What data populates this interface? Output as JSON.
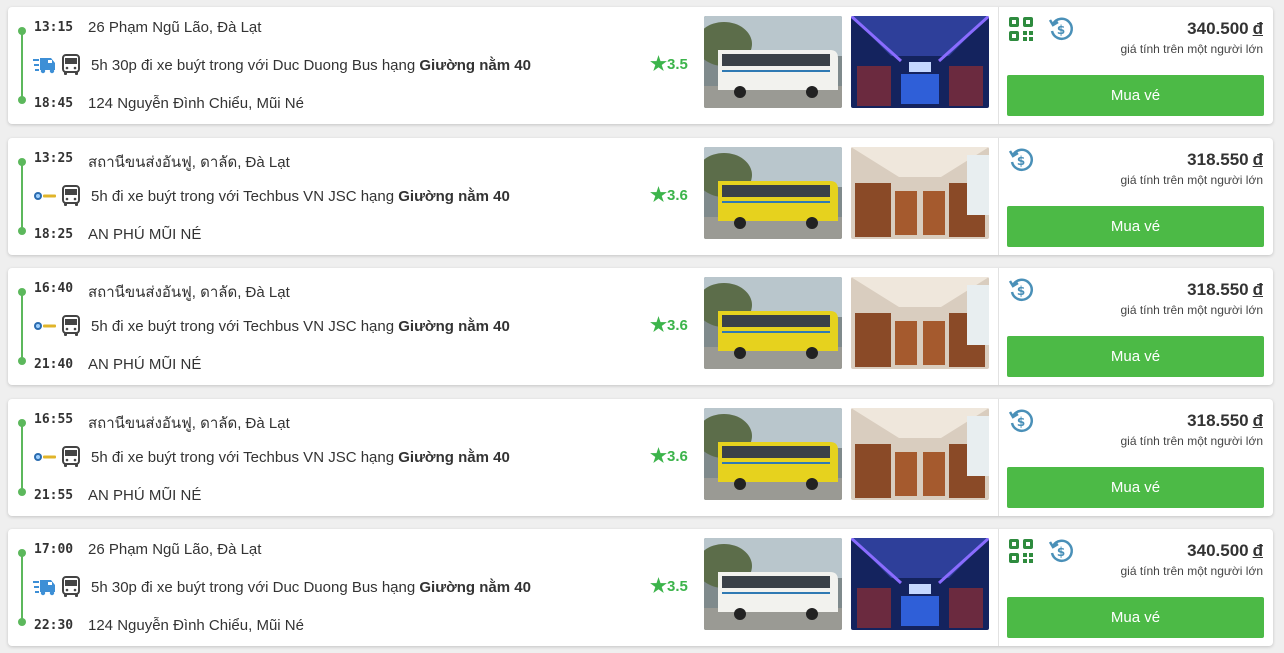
{
  "trips": [
    {
      "departure_time": "13:15",
      "departure_stop": "26 Phạm Ngũ Lão, Đà Lạt",
      "arrival_time": "18:45",
      "arrival_stop": "124 Nguyễn Đình Chiểu, Mũi Né",
      "operator_logo": "fast-bus-icon",
      "desc_prefix": "5h 30p đi xe buýt trong với Duc Duong Bus hạng ",
      "seat_class": "Giường nằm 40",
      "rating": "3.5",
      "features": [
        "qr-code-icon",
        "refund-icon"
      ],
      "price": "340.500",
      "currency": "đ",
      "price_note": "giá tính trên một người lớn",
      "buy_label": "Mua vé"
    },
    {
      "departure_time": "13:25",
      "departure_stop": "สถานีขนส่งอันฟู, ดาลัด, Đà Lạt",
      "arrival_time": "18:25",
      "arrival_stop": "AN PHÚ MŨI NÉ",
      "operator_logo": "techbus-logo",
      "desc_prefix": "5h đi xe buýt trong với Techbus VN JSC hạng ",
      "seat_class": "Giường nằm 40",
      "rating": "3.6",
      "features": [
        "refund-icon"
      ],
      "price": "318.550",
      "currency": "đ",
      "price_note": "giá tính trên một người lớn",
      "buy_label": "Mua vé"
    },
    {
      "departure_time": "16:40",
      "departure_stop": "สถานีขนส่งอันฟู, ดาลัด, Đà Lạt",
      "arrival_time": "21:40",
      "arrival_stop": "AN PHÚ MŨI NÉ",
      "operator_logo": "techbus-logo",
      "desc_prefix": "5h đi xe buýt trong với Techbus VN JSC hạng ",
      "seat_class": "Giường nằm 40",
      "rating": "3.6",
      "features": [
        "refund-icon"
      ],
      "price": "318.550",
      "currency": "đ",
      "price_note": "giá tính trên một người lớn",
      "buy_label": "Mua vé"
    },
    {
      "departure_time": "16:55",
      "departure_stop": "สถานีขนส่งอันฟู, ดาลัด, Đà Lạt",
      "arrival_time": "21:55",
      "arrival_stop": "AN PHÚ MŨI NÉ",
      "operator_logo": "techbus-logo",
      "desc_prefix": "5h đi xe buýt trong với Techbus VN JSC hạng ",
      "seat_class": "Giường nằm 40",
      "rating": "3.6",
      "features": [
        "refund-icon"
      ],
      "price": "318.550",
      "currency": "đ",
      "price_note": "giá tính trên một người lớn",
      "buy_label": "Mua vé"
    },
    {
      "departure_time": "17:00",
      "departure_stop": "26 Phạm Ngũ Lão, Đà Lạt",
      "arrival_time": "22:30",
      "arrival_stop": "124 Nguyễn Đình Chiểu, Mũi Né",
      "operator_logo": "fast-bus-icon",
      "desc_prefix": "5h 30p đi xe buýt trong với Duc Duong Bus hạng ",
      "seat_class": "Giường nằm 40",
      "rating": "3.5",
      "features": [
        "qr-code-icon",
        "refund-icon"
      ],
      "price": "340.500",
      "currency": "đ",
      "price_note": "giá tính trên một người lớn",
      "buy_label": "Mua vé"
    }
  ],
  "colors": {
    "accent_green": "#4cba46",
    "timeline_green": "#5cb85c",
    "rating_green": "#3cb44b",
    "icon_blue": "#3d8fd6",
    "refund_blue": "#4a90b8",
    "qr_green": "#2e8b3e",
    "techbus_yellow": "#e6d21e",
    "duc_duong_white": "#f2f2ee"
  }
}
